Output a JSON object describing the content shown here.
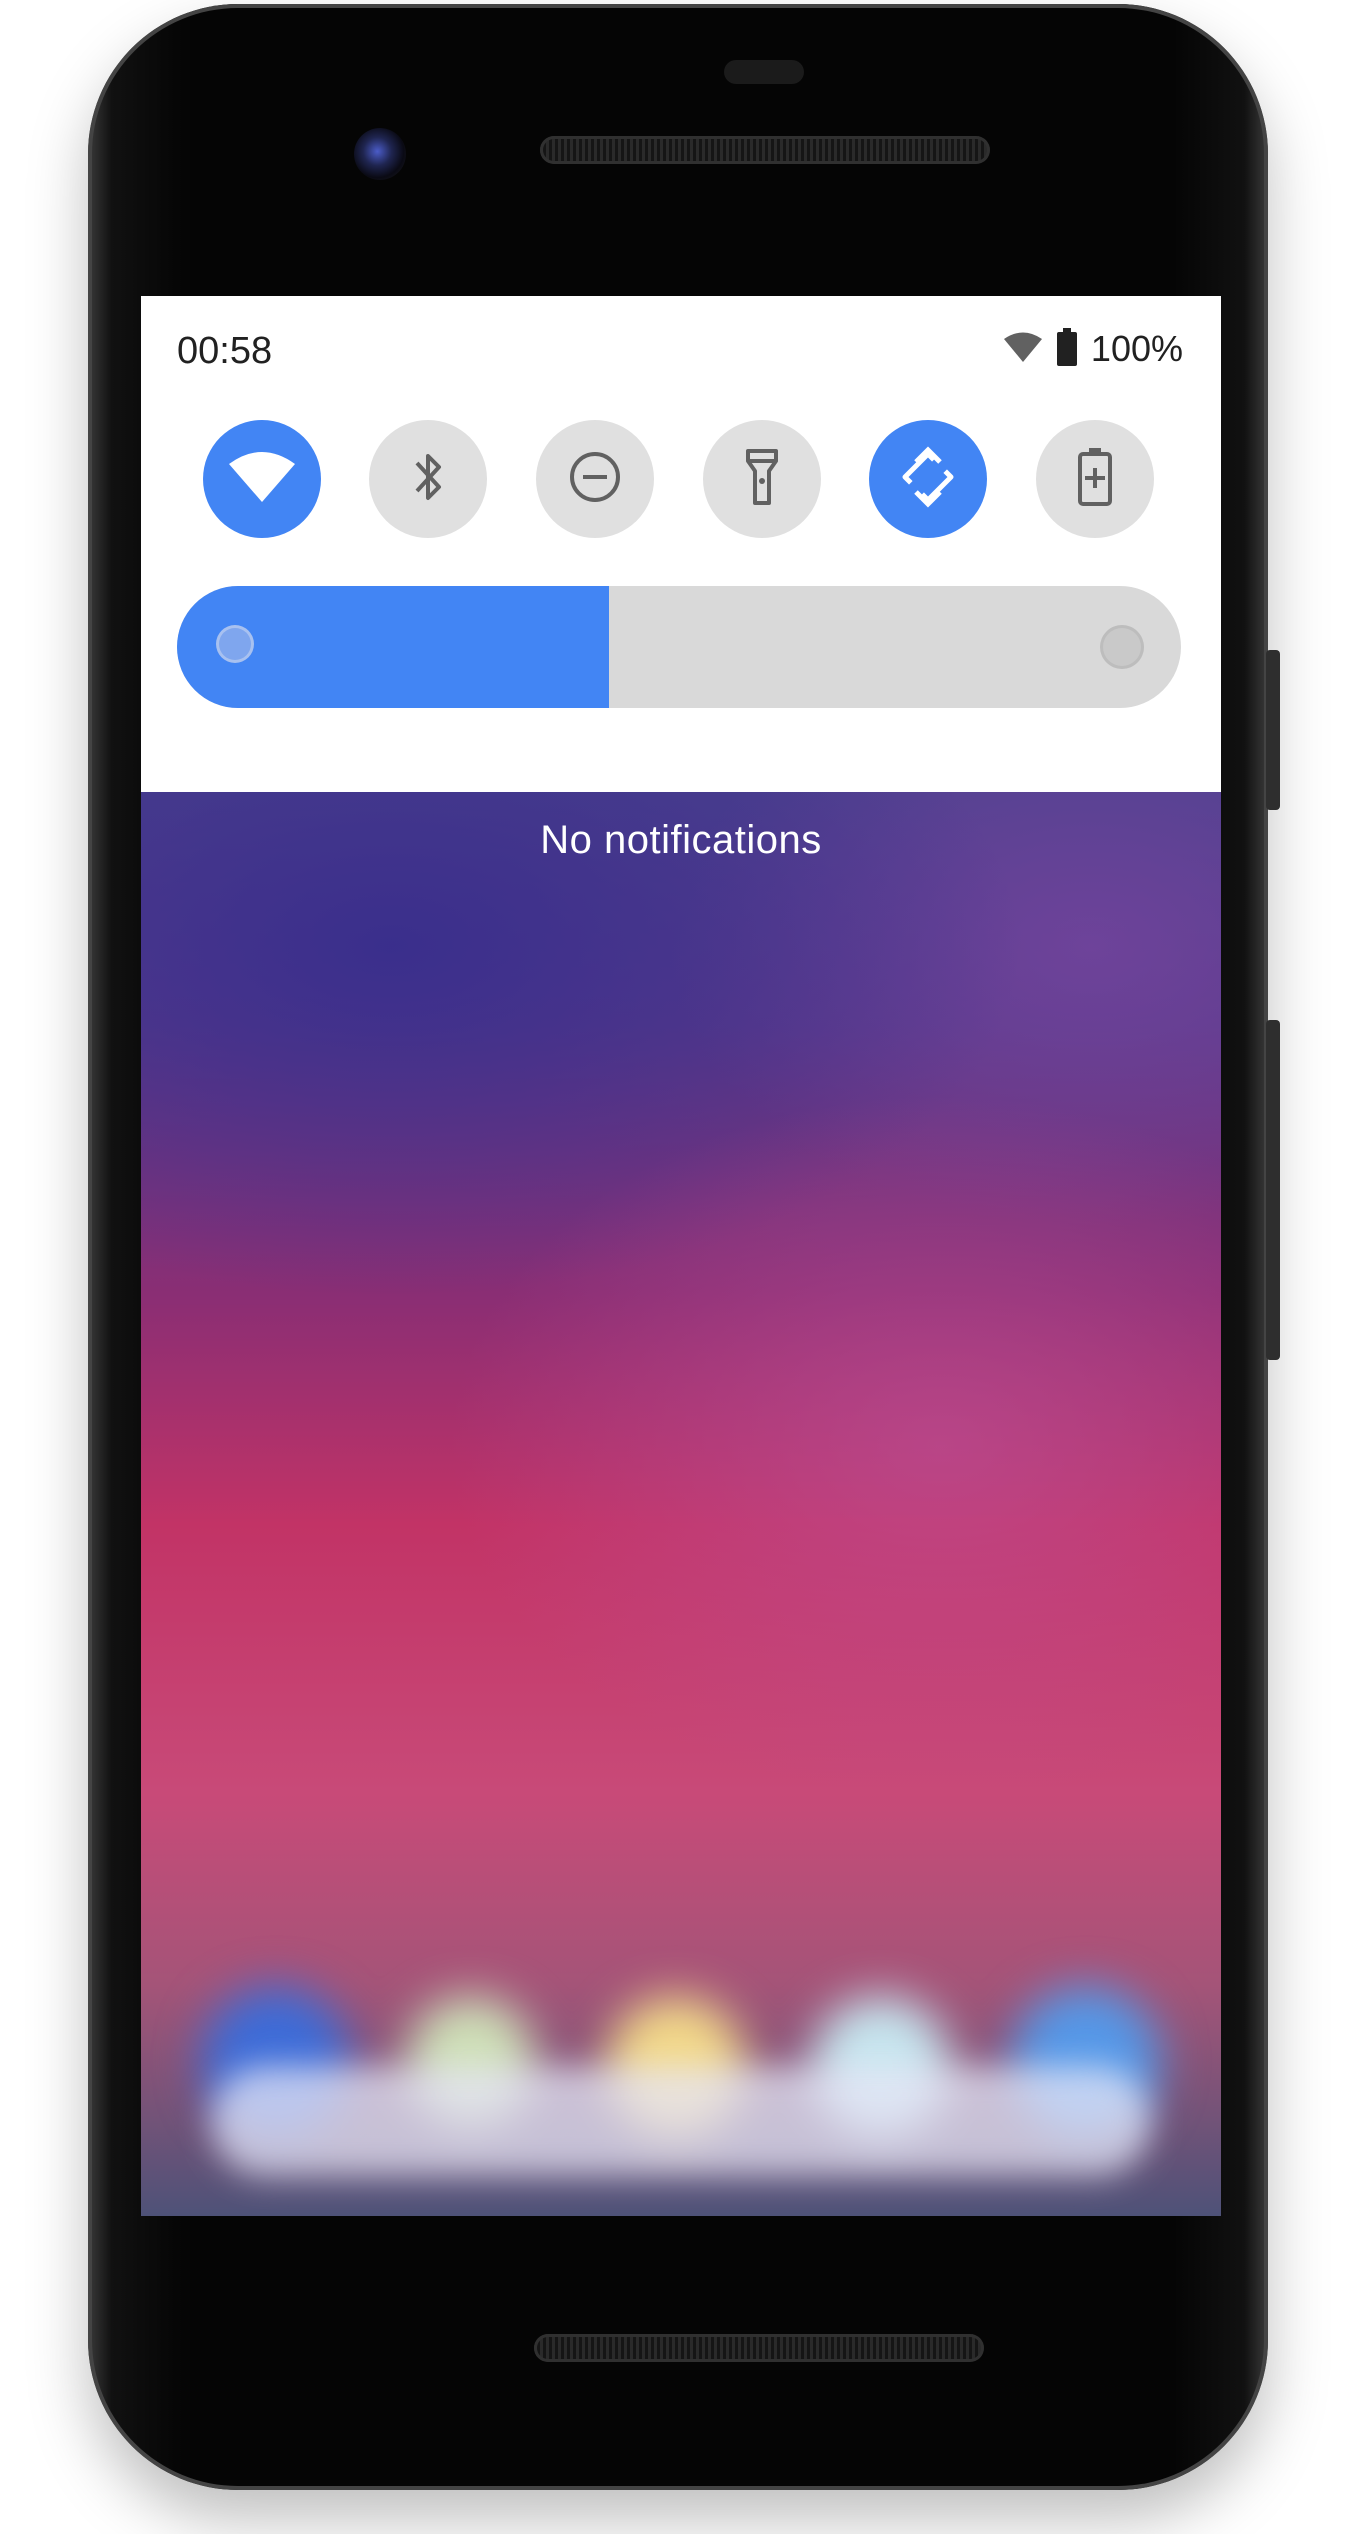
{
  "status_bar": {
    "time": "00:58",
    "battery_percent": "100%",
    "icons": [
      "wifi-icon",
      "battery-icon"
    ]
  },
  "quick_settings": {
    "tiles": [
      {
        "name": "wifi",
        "icon": "wifi-icon",
        "state": "on"
      },
      {
        "name": "bluetooth",
        "icon": "bluetooth-icon",
        "state": "off"
      },
      {
        "name": "do-not-disturb",
        "icon": "do-not-disturb-icon",
        "state": "off"
      },
      {
        "name": "flashlight",
        "icon": "flashlight-icon",
        "state": "off"
      },
      {
        "name": "auto-rotate",
        "icon": "auto-rotate-icon",
        "state": "on"
      },
      {
        "name": "battery-saver",
        "icon": "battery-saver-icon",
        "state": "off"
      }
    ],
    "brightness_level": 0.43,
    "accent_color": "#4285f4",
    "tile_off_color": "#e0e0e0"
  },
  "notifications": {
    "empty_text": "No notifications"
  }
}
